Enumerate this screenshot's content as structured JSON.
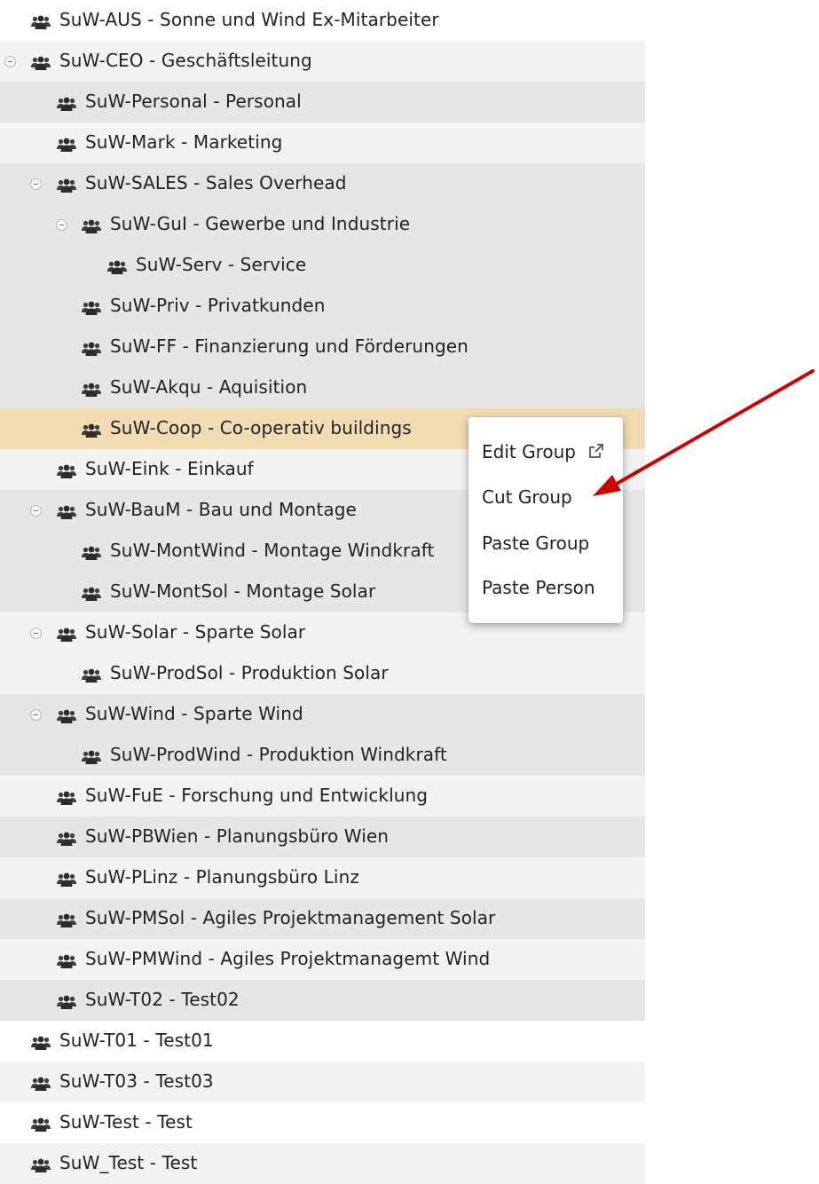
{
  "tree": {
    "rows": [
      {
        "label": "SuW-AUS - Sonne und Wind Ex-Mitarbeiter",
        "level": 0,
        "toggle": false,
        "bg": "white"
      },
      {
        "label": "SuW-CEO - Geschäftsleitung",
        "level": 0,
        "toggle": true,
        "bg": "light"
      },
      {
        "label": "SuW-Personal - Personal",
        "level": 1,
        "toggle": false,
        "bg": "shade"
      },
      {
        "label": "SuW-Mark - Marketing",
        "level": 1,
        "toggle": false,
        "bg": "light"
      },
      {
        "label": "SuW-SALES - Sales Overhead",
        "level": 1,
        "toggle": true,
        "bg": "shade"
      },
      {
        "label": "SuW-GuI - Gewerbe und Industrie",
        "level": 2,
        "toggle": true,
        "bg": "shade"
      },
      {
        "label": "SuW-Serv - Service",
        "level": 3,
        "toggle": false,
        "bg": "shade"
      },
      {
        "label": "SuW-Priv - Privatkunden",
        "level": 2,
        "toggle": false,
        "bg": "shade"
      },
      {
        "label": "SuW-FF - Finanzierung und Förderungen",
        "level": 2,
        "toggle": false,
        "bg": "shade"
      },
      {
        "label": "SuW-Akqu - Aquisition",
        "level": 2,
        "toggle": false,
        "bg": "shade"
      },
      {
        "label": "SuW-Coop - Co-operativ buildings",
        "level": 2,
        "toggle": false,
        "bg": "selected"
      },
      {
        "label": "SuW-Eink - Einkauf",
        "level": 1,
        "toggle": false,
        "bg": "light"
      },
      {
        "label": "SuW-BauM - Bau und Montage",
        "level": 1,
        "toggle": true,
        "bg": "shade"
      },
      {
        "label": "SuW-MontWind - Montage Windkraft",
        "level": 2,
        "toggle": false,
        "bg": "shade"
      },
      {
        "label": "SuW-MontSol - Montage Solar",
        "level": 2,
        "toggle": false,
        "bg": "shade"
      },
      {
        "label": "SuW-Solar - Sparte Solar",
        "level": 1,
        "toggle": true,
        "bg": "light"
      },
      {
        "label": "SuW-ProdSol - Produktion Solar",
        "level": 2,
        "toggle": false,
        "bg": "light"
      },
      {
        "label": "SuW-Wind - Sparte Wind",
        "level": 1,
        "toggle": true,
        "bg": "shade"
      },
      {
        "label": "SuW-ProdWind - Produktion Windkraft",
        "level": 2,
        "toggle": false,
        "bg": "shade"
      },
      {
        "label": "SuW-FuE - Forschung und Entwicklung",
        "level": 1,
        "toggle": false,
        "bg": "light"
      },
      {
        "label": "SuW-PBWien - Planungsbüro Wien",
        "level": 1,
        "toggle": false,
        "bg": "shade"
      },
      {
        "label": "SuW-PLinz - Planungsbüro Linz",
        "level": 1,
        "toggle": false,
        "bg": "light"
      },
      {
        "label": "SuW-PMSol - Agiles Projektmanagement Solar",
        "level": 1,
        "toggle": false,
        "bg": "shade"
      },
      {
        "label": "SuW-PMWind - Agiles Projektmanagemt Wind",
        "level": 1,
        "toggle": false,
        "bg": "light"
      },
      {
        "label": "SuW-T02 - Test02",
        "level": 1,
        "toggle": false,
        "bg": "shade"
      },
      {
        "label": "SuW-T01 - Test01",
        "level": 0,
        "toggle": false,
        "bg": "white"
      },
      {
        "label": "SuW-T03 - Test03",
        "level": 0,
        "toggle": false,
        "bg": "light"
      },
      {
        "label": "SuW-Test - Test",
        "level": 0,
        "toggle": false,
        "bg": "white"
      },
      {
        "label": "SuW_Test - Test",
        "level": 0,
        "toggle": false,
        "bg": "light"
      }
    ]
  },
  "context_menu": {
    "items": [
      {
        "label": "Edit Group",
        "icon": "external-link-icon"
      },
      {
        "label": "Cut Group"
      },
      {
        "label": "Paste Group"
      },
      {
        "label": "Paste Person"
      }
    ]
  },
  "icons": {
    "group": "group-icon",
    "toggle": "collapse-toggle-icon"
  },
  "colors": {
    "selected_row": "#f2dcb4",
    "shaded_row": "#e6e6e6",
    "light_row": "#f3f3f3",
    "annotation_arrow": "#cc0000"
  }
}
